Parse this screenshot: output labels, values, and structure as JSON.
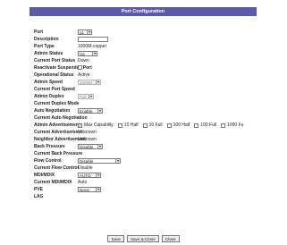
{
  "header": {
    "title": "Port Configuration"
  },
  "fields": {
    "port": {
      "label": "Port",
      "value": "g1"
    },
    "description": {
      "label": "Description",
      "value": ""
    },
    "port_type": {
      "label": "Port Type",
      "value": "1000M-copper"
    },
    "admin_status": {
      "label": "Admin Status",
      "value": "Up"
    },
    "current_port_status": {
      "label": "Current Port Status",
      "value": "Down"
    },
    "reactivate_suspended_port": {
      "label": "Reactivate Suspended Port",
      "checked": false
    },
    "operational_status": {
      "label": "Operational Status",
      "value": "Active"
    },
    "admin_speed": {
      "label": "Admin Speed",
      "value": "1000M"
    },
    "current_port_speed": {
      "label": "Current Port Speed",
      "value": ""
    },
    "admin_duplex": {
      "label": "Admin Duplex",
      "value": "Full"
    },
    "current_duplex_mode": {
      "label": "Current Duplex Mode",
      "value": ""
    },
    "auto_negotiation": {
      "label": "Auto Negotiation",
      "value": "Enable"
    },
    "current_auto_negotiation": {
      "label": "Current Auto Negotiation",
      "value": ""
    },
    "admin_advertisement": {
      "label": "Admin Advertisement",
      "options": [
        {
          "label": "Max Capability",
          "checked": true
        },
        {
          "label": "10 Half",
          "checked": false
        },
        {
          "label": "10 Full",
          "checked": false
        },
        {
          "label": "100 Half",
          "checked": false
        },
        {
          "label": "100 Full",
          "checked": false
        },
        {
          "label": "1000 Fu",
          "checked": false
        }
      ]
    },
    "current_advertisement": {
      "label": "Current Advertisement",
      "value": "Unknown"
    },
    "neighbor_advertisement": {
      "label": "Neighbor Advertisement",
      "value": "Unknown"
    },
    "back_pressure": {
      "label": "Back Pressure",
      "value": "Disable"
    },
    "current_back_pressure": {
      "label": "Current Back Pressure",
      "value": ""
    },
    "flow_control": {
      "label": "Flow Control",
      "value": "Disable"
    },
    "current_flow_control": {
      "label": "Current Flow Control",
      "value": "Disable"
    },
    "mdi_mdix": {
      "label": "MDI/MDIX",
      "value": "AUTO"
    },
    "current_mdi_mdix": {
      "label": "Current MDI/MDIX",
      "value": "Auto"
    },
    "pve": {
      "label": "PVE",
      "value": "None"
    },
    "lag": {
      "label": "LAG",
      "value": ""
    }
  },
  "buttons": {
    "save": "Save",
    "save_close": "Save & Close",
    "close": "Close"
  },
  "icons": {
    "dropdown": "chevron-down-icon",
    "check": "check-icon"
  }
}
